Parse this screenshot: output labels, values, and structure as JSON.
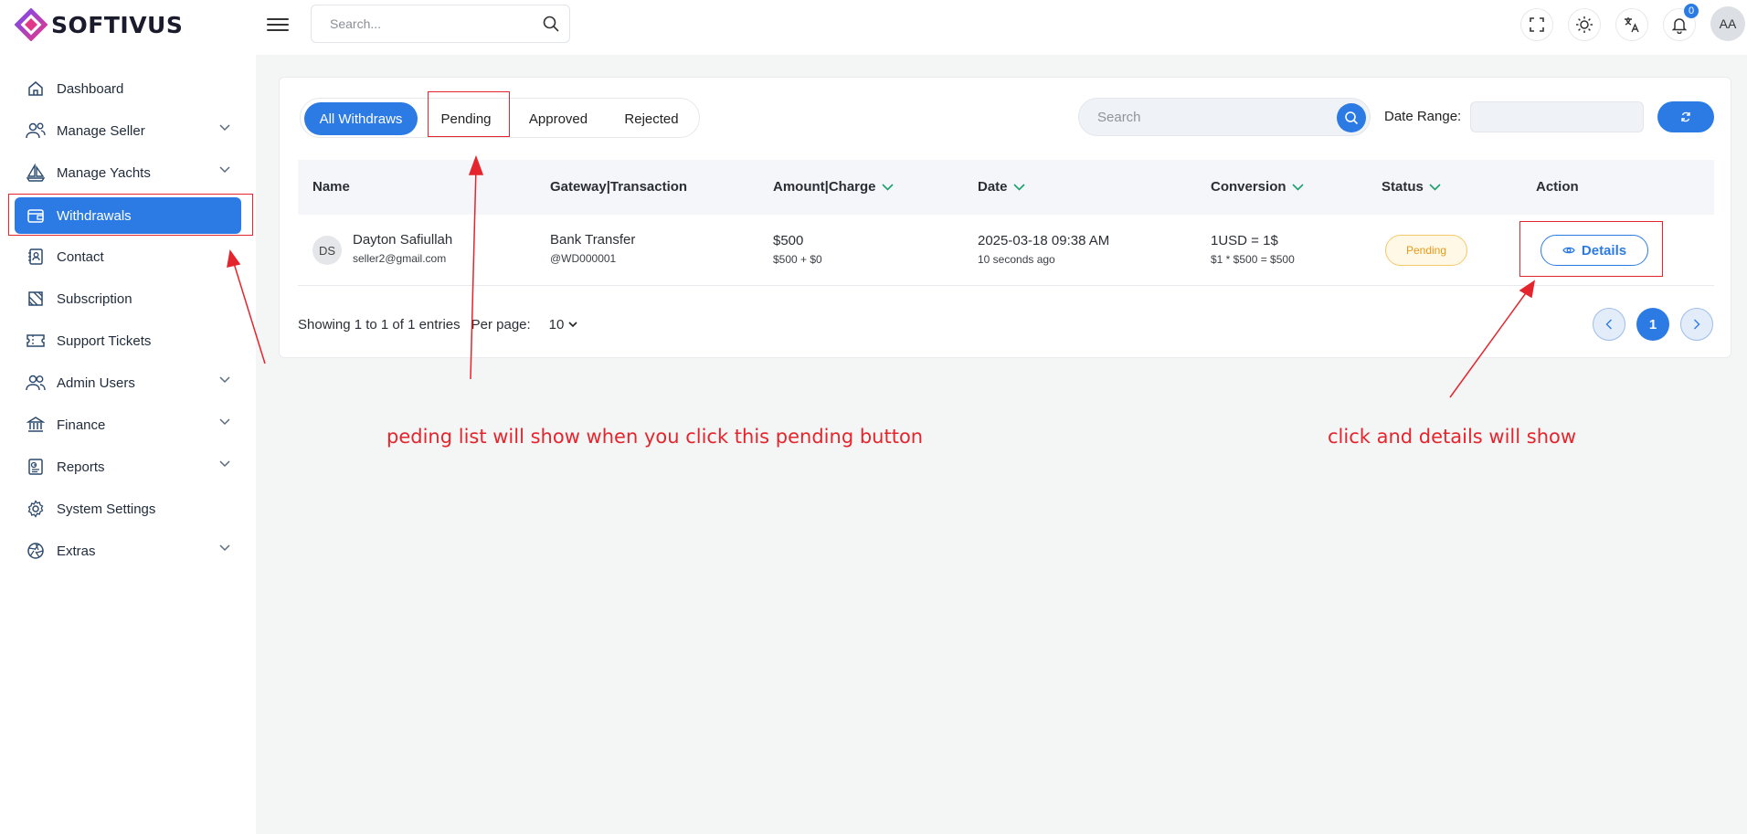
{
  "app": {
    "logo_text": "SOFTIVUS",
    "brand_colors": [
      "#7b4bf0",
      "#e2388a",
      "#2c7be5"
    ]
  },
  "topbar": {
    "search_placeholder": "Search...",
    "notification_count": "0",
    "avatar_initials": "AA"
  },
  "sidebar": {
    "items": [
      {
        "label": "Dashboard",
        "icon": "home-icon",
        "expandable": false
      },
      {
        "label": "Manage Seller",
        "icon": "users-icon",
        "expandable": true
      },
      {
        "label": "Manage Yachts",
        "icon": "sailboat-icon",
        "expandable": true
      },
      {
        "label": "Withdrawals",
        "icon": "wallet-icon",
        "expandable": false,
        "active": true
      },
      {
        "label": "Contact",
        "icon": "contact-book-icon",
        "expandable": false
      },
      {
        "label": "Subscription",
        "icon": "subscription-icon",
        "expandable": false
      },
      {
        "label": "Support Tickets",
        "icon": "ticket-icon",
        "expandable": false
      },
      {
        "label": "Admin Users",
        "icon": "admin-users-icon",
        "expandable": true
      },
      {
        "label": "Finance",
        "icon": "bank-icon",
        "expandable": true
      },
      {
        "label": "Reports",
        "icon": "report-icon",
        "expandable": true
      },
      {
        "label": "System Settings",
        "icon": "gear-icon",
        "expandable": false
      },
      {
        "label": "Extras",
        "icon": "aperture-icon",
        "expandable": true
      }
    ]
  },
  "main": {
    "tabs": [
      {
        "label": "All Withdraws",
        "active": true
      },
      {
        "label": "Pending",
        "active": false
      },
      {
        "label": "Approved",
        "active": false
      },
      {
        "label": "Rejected",
        "active": false
      }
    ],
    "search_placeholder": "Search",
    "date_range_label": "Date Range:",
    "date_range_value": "",
    "table": {
      "headers": [
        "Name",
        "Gateway|Transaction",
        "Amount|Charge",
        "Date",
        "Conversion",
        "Status",
        "Action"
      ],
      "sortable": [
        false,
        false,
        true,
        true,
        true,
        true,
        false
      ],
      "rows": [
        {
          "initials": "DS",
          "name": "Dayton Safiullah",
          "email": "seller2@gmail.com",
          "gateway": "Bank Transfer",
          "transaction": "@WD000001",
          "amount": "$500",
          "charge": "$500 + $0",
          "date": "2025-03-18 09:38 AM",
          "date_relative": "10 seconds ago",
          "conversion": "1USD = 1$",
          "conversion_calc": "$1 * $500 = $500",
          "status": "Pending",
          "action_label": "Details"
        }
      ]
    },
    "footer": {
      "showing": "Showing 1 to 1 of 1 entries",
      "per_page_label": "Per page:",
      "per_page_value": "10",
      "current_page": "1"
    }
  },
  "annotations": {
    "pending_note": "peding list will show when you click this pending button",
    "details_note": "click and details will show",
    "color": "#e5252d"
  }
}
